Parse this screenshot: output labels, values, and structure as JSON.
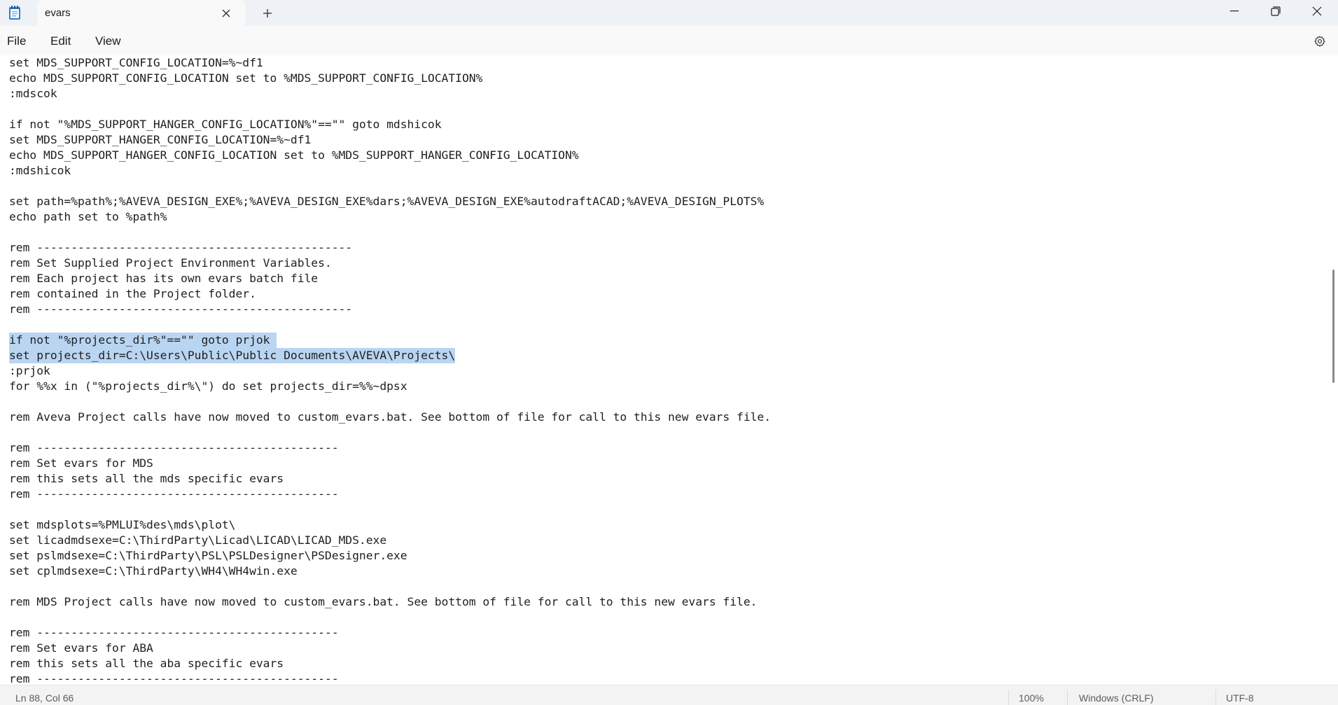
{
  "window": {
    "tab_title": "evars",
    "icons": {
      "app": "notepad-icon",
      "tab_close": "close-icon",
      "new_tab": "plus-icon",
      "minimize": "minimize-icon",
      "maximize": "restore-icon",
      "close": "close-icon",
      "settings": "gear-icon"
    }
  },
  "menu": {
    "file": "File",
    "edit": "Edit",
    "view": "View"
  },
  "editor": {
    "selection_color": "#b9d5f2",
    "lines": [
      "set MDS_SUPPORT_CONFIG_LOCATION=%~df1",
      "echo MDS_SUPPORT_CONFIG_LOCATION set to %MDS_SUPPORT_CONFIG_LOCATION%",
      ":mdscok",
      "",
      "if not \"%MDS_SUPPORT_HANGER_CONFIG_LOCATION%\"==\"\" goto mdshicok",
      "set MDS_SUPPORT_HANGER_CONFIG_LOCATION=%~df1",
      "echo MDS_SUPPORT_HANGER_CONFIG_LOCATION set to %MDS_SUPPORT_HANGER_CONFIG_LOCATION%",
      ":mdshicok",
      "",
      "set path=%path%;%AVEVA_DESIGN_EXE%;%AVEVA_DESIGN_EXE%dars;%AVEVA_DESIGN_EXE%autodraftACAD;%AVEVA_DESIGN_PLOTS%",
      "echo path set to %path%",
      "",
      "rem ----------------------------------------------",
      "rem Set Supplied Project Environment Variables.",
      "rem Each project has its own evars batch file",
      "rem contained in the Project folder.",
      "rem ----------------------------------------------",
      "",
      "if not \"%projects_dir%\"==\"\" goto prjok ",
      "set projects_dir=C:\\Users\\Public\\Public Documents\\AVEVA\\Projects\\",
      ":prjok",
      "for %%x in (\"%projects_dir%\\\") do set projects_dir=%%~dpsx",
      "",
      "rem Aveva Project calls have now moved to custom_evars.bat. See bottom of file for call to this new evars file.",
      "",
      "rem --------------------------------------------",
      "rem Set evars for MDS",
      "rem this sets all the mds specific evars",
      "rem --------------------------------------------",
      "",
      "set mdsplots=%PMLUI%des\\mds\\plot\\",
      "set licadmdsexe=C:\\ThirdParty\\Licad\\LICAD\\LICAD_MDS.exe",
      "set pslmdsexe=C:\\ThirdParty\\PSL\\PSLDesigner\\PSDesigner.exe",
      "set cplmdsexe=C:\\ThirdParty\\WH4\\WH4win.exe",
      "",
      "rem MDS Project calls have now moved to custom_evars.bat. See bottom of file for call to this new evars file.",
      "",
      "rem --------------------------------------------",
      "rem Set evars for ABA",
      "rem this sets all the aba specific evars",
      "rem --------------------------------------------"
    ],
    "selected_lines": [
      18,
      19
    ]
  },
  "status": {
    "position": "Ln 88, Col 66",
    "zoom": "100%",
    "line_ending": "Windows (CRLF)",
    "encoding": "UTF-8"
  }
}
